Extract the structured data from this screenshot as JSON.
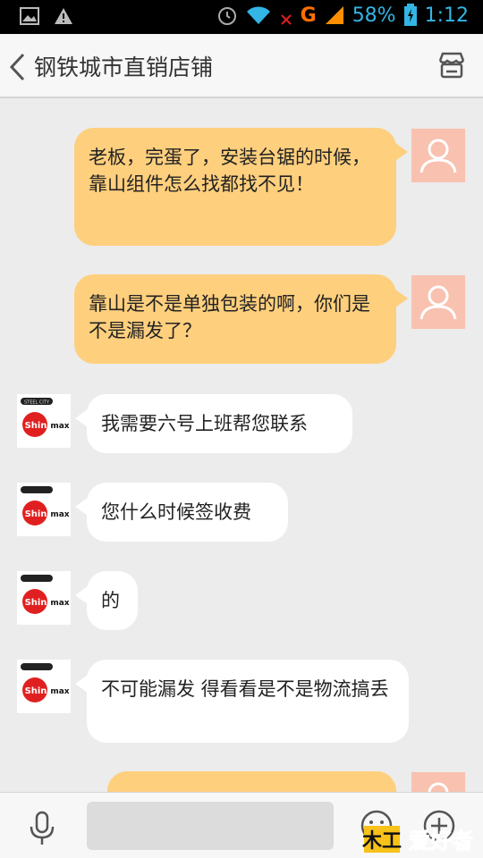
{
  "status_bar": {
    "battery": "58%",
    "time": "1:12",
    "network": "G"
  },
  "header": {
    "title": "钢铁城市直销店铺"
  },
  "messages": [
    {
      "side": "out",
      "text": "老板，完蛋了，安装台锯的时候，靠山组件怎么找都找不见！"
    },
    {
      "side": "out",
      "text": "靠山是不是单独包装的啊，你们是不是漏发了？"
    },
    {
      "side": "in",
      "text": "我需要六号上班帮您联系"
    },
    {
      "side": "in",
      "text": "您什么时候签收费"
    },
    {
      "side": "in",
      "text": "的"
    },
    {
      "side": "in",
      "text": "不可能漏发 得看看是不是物流搞丢"
    }
  ],
  "shop_logo": {
    "line1": "STEEL CITY",
    "line2": "Shinmax"
  },
  "watermark": "爱好者"
}
